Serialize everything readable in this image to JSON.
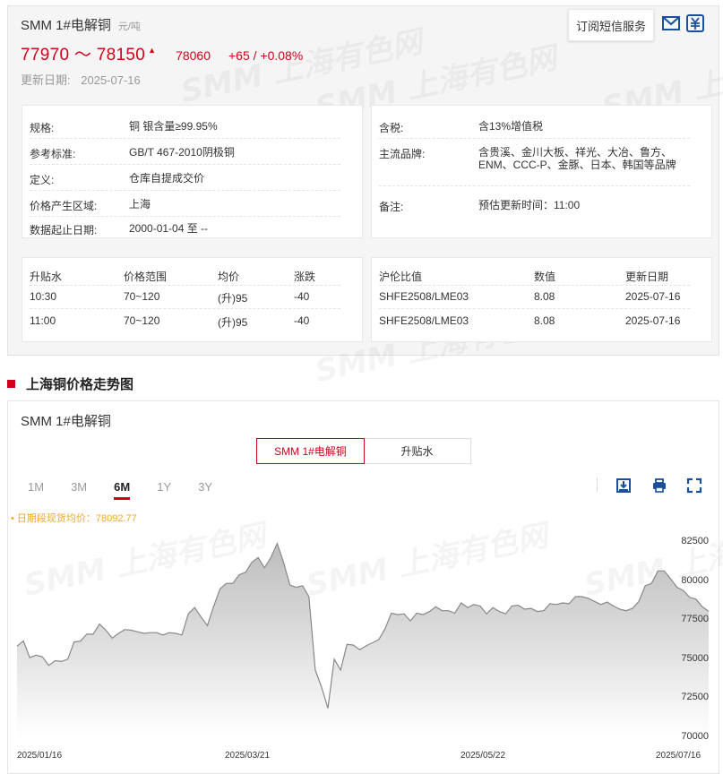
{
  "header": {
    "title": "SMM 1#电解铜",
    "unit": "元/吨",
    "price_range": "77970 ～ 78150",
    "avg_price": "78060",
    "change": "+65  /  +0.08%",
    "update_label": "更新日期:",
    "update_date": "2025-07-16",
    "subscribe_label": "订阅短信服务",
    "accent_color": "#d0021b"
  },
  "spec_left": [
    {
      "k": "规格:",
      "v": "铜 银含量≥99.95%"
    },
    {
      "k": "参考标准:",
      "v": "GB/T 467-2010阴极铜"
    },
    {
      "k": "定义:",
      "v": "仓库自提成交价"
    },
    {
      "k": "价格产生区域:",
      "v": "上海"
    },
    {
      "k": "数据起止日期:",
      "v": "2000-01-04 至 --"
    }
  ],
  "spec_right": [
    {
      "k": "含税:",
      "v": "含13%增值税"
    },
    {
      "k": "主流品牌:",
      "v": "含贵溪、金川大板、祥光、大冶、鲁方、",
      "v2": "ENM、CCC-P、金豚、日本、韩国等品牌"
    },
    {
      "k": "备注:",
      "v": "预估更新时间：11:00"
    }
  ],
  "premium_table": {
    "headers": [
      "升贴水",
      "价格范围",
      "均价",
      "涨跌"
    ],
    "rows": [
      [
        "10:30",
        "70~120",
        "(升)95",
        "-40"
      ],
      [
        "11:00",
        "70~120",
        "(升)95",
        "-40"
      ]
    ]
  },
  "ratio_table": {
    "headers": [
      "沪伦比值",
      "数值",
      "更新日期"
    ],
    "rows": [
      [
        "SHFE2508/LME03",
        "8.08",
        "2025-07-16"
      ],
      [
        "SHFE2508/LME03",
        "8.08",
        "2025-07-16"
      ]
    ]
  },
  "section_title": "上海铜价格走势图",
  "chart_panel": {
    "title": "SMM 1#电解铜",
    "toggle": [
      "SMM 1#电解铜",
      "升贴水"
    ],
    "ranges": [
      "1M",
      "3M",
      "6M",
      "1Y",
      "3Y"
    ],
    "avg_note": "• 日期段现货均价：78092.77",
    "watermark": "SMM 上海有色网"
  },
  "chart_data": {
    "type": "area",
    "title": "",
    "xlabel": "",
    "ylabel": "",
    "ylim": [
      70000,
      82500
    ],
    "yticks": [
      "82500",
      "80000",
      "77500",
      "75000",
      "72500",
      "70000"
    ],
    "xticks": [
      "2025/01/16",
      "2025/03/21",
      "2025/05/22",
      "2025/07/16"
    ],
    "colors": {
      "line": "#888888",
      "fill_top": "#bdbdbd",
      "fill_bottom": "#ffffff"
    },
    "grid": false,
    "series": [
      {
        "values": [
          75830,
          76170,
          75100,
          75250,
          75150,
          74600,
          74900,
          74850,
          75000,
          76100,
          76150,
          76600,
          76600,
          77250,
          76850,
          76350,
          76650,
          76900,
          76850,
          76750,
          76650,
          76700,
          76700,
          76550,
          76700,
          76650,
          76550,
          77900,
          78300,
          77700,
          77150,
          78400,
          79500,
          79850,
          79850,
          80400,
          80550,
          81200,
          81500,
          80850,
          81500,
          82400,
          81200,
          79750,
          79600,
          79700,
          79000,
          74300,
          73200,
          71850,
          75000,
          74300,
          75950,
          75900,
          75600,
          75850,
          76050,
          76250,
          76950,
          77950,
          77850,
          77900,
          77450,
          77950,
          77850,
          78050,
          78350,
          78100,
          78100,
          77950,
          78600,
          78300,
          78500,
          78400,
          77900,
          78300,
          78050,
          77900,
          78400,
          78450,
          78200,
          78250,
          78050,
          78100,
          78550,
          78500,
          78600,
          78550,
          79000,
          79000,
          78900,
          78700,
          78500,
          78650,
          78400,
          78200,
          78100,
          78250,
          78700,
          79700,
          79850,
          80650,
          80650,
          80150,
          79600,
          79400,
          78950,
          78850,
          78350,
          78060
        ]
      }
    ]
  }
}
